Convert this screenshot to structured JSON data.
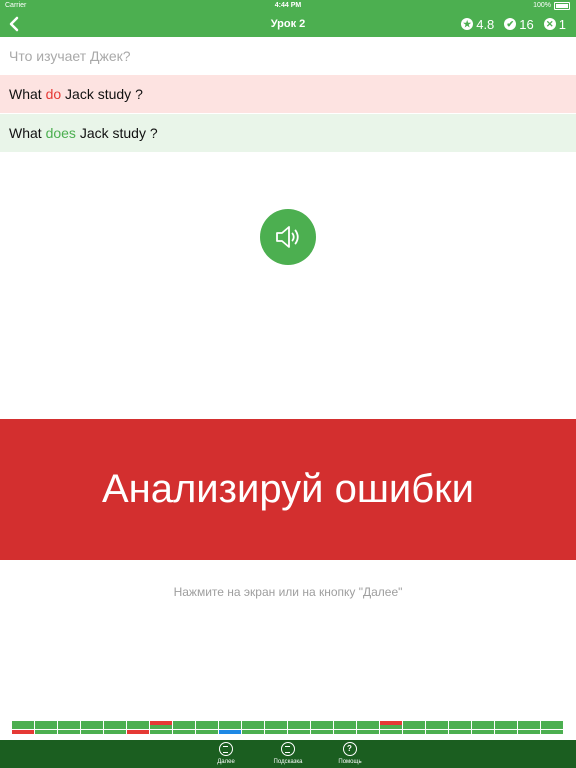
{
  "status_bar": {
    "carrier": "Carrier",
    "time": "4:44 PM",
    "battery": "100%"
  },
  "nav": {
    "title": "Урок 2",
    "rating": "4.8",
    "correct_count": "16",
    "wrong_count": "1"
  },
  "exercise": {
    "prompt": "Что изучает Джек?",
    "wrong_answer": {
      "before": "What ",
      "highlight": "do",
      "after": " Jack study ?"
    },
    "correct_answer": {
      "before": "What ",
      "highlight": "does",
      "after": " Jack study ?"
    }
  },
  "banner": {
    "text": "Анализируй ошибки"
  },
  "hint": "Нажмите на экран или на кнопку \"Далее\"",
  "progress": {
    "columns": 24,
    "top_row_red": [
      6,
      16
    ],
    "bottom_row_red": [
      0,
      5
    ],
    "bottom_row_blue": [
      9
    ]
  },
  "toolbar": {
    "next_label": "Далее",
    "hint_label": "Подсказка",
    "help_label": "Помощь"
  },
  "colors": {
    "accent_green": "#4caf50",
    "toolbar_green": "#1b5e20",
    "error_red": "#d32f2f",
    "wrong_bg": "#fde3e1",
    "right_bg": "#e9f5e9"
  }
}
